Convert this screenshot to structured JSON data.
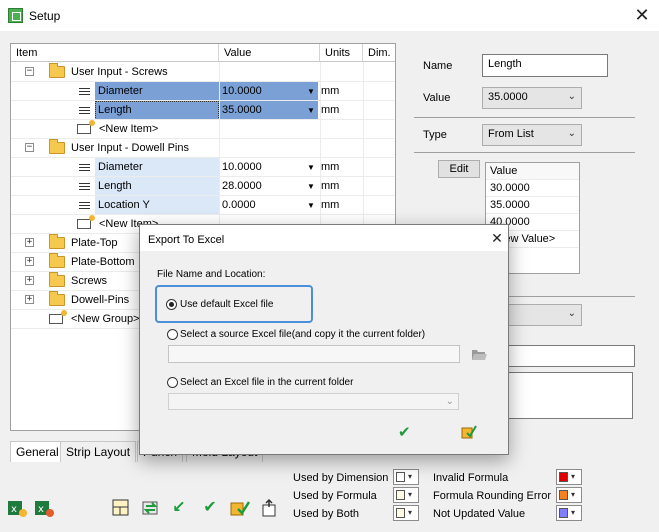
{
  "window": {
    "title": "Setup",
    "close_glyph": "✕"
  },
  "colors": {
    "selection": "#7aa0d6",
    "light_selection": "#dbe8f8",
    "invalid_formula": "#e10000",
    "rounding_error": "#f5821f",
    "not_updated": "#8080ff",
    "check_green": "#1e9b3c",
    "dialog_focus": "#4a90d9"
  },
  "tree": {
    "columns": [
      "Item",
      "Value",
      "Units",
      "Dim."
    ],
    "rows": [
      {
        "kind": "group",
        "expander": "−",
        "label": "User Input - Screws"
      },
      {
        "kind": "item",
        "name": "Diameter",
        "value": "10.0000",
        "units": "mm",
        "state": "selected"
      },
      {
        "kind": "item",
        "name": "Length",
        "value": "35.0000",
        "units": "mm",
        "state": "selected-focus"
      },
      {
        "kind": "new",
        "label": "<New Item>"
      },
      {
        "kind": "group",
        "expander": "−",
        "label": "User Input - Dowell Pins"
      },
      {
        "kind": "item",
        "name": "Diameter",
        "value": "10.0000",
        "units": "mm",
        "state": "light"
      },
      {
        "kind": "item",
        "name": "Length",
        "value": "28.0000",
        "units": "mm",
        "state": "light"
      },
      {
        "kind": "item",
        "name": "Location Y",
        "value": "0.0000",
        "units": "mm",
        "state": "light"
      },
      {
        "kind": "new",
        "label": "<New Item>"
      },
      {
        "kind": "group",
        "expander": "+",
        "label": "Plate-Top"
      },
      {
        "kind": "group",
        "expander": "+",
        "label": "Plate-Bottom"
      },
      {
        "kind": "group",
        "expander": "+",
        "label": "Screws"
      },
      {
        "kind": "group",
        "expander": "+",
        "label": "Dowell-Pins"
      },
      {
        "kind": "newgroup",
        "label": "<New Group>"
      }
    ]
  },
  "props": {
    "name_label": "Name",
    "name_value": "Length",
    "value_label": "Value",
    "value_value": "35.0000",
    "type_label": "Type",
    "type_value": "From List",
    "edit_button": "Edit",
    "list_header": "Value",
    "list_values": [
      "30.0000",
      "35.0000",
      "40.0000",
      "<New Value>"
    ]
  },
  "tabs": [
    "General",
    "Strip Layout",
    "Punch",
    "Mold Layout"
  ],
  "legend": {
    "used_by_dimension": "Used by Dimension",
    "used_by_formula": "Used by Formula",
    "used_by_both": "Used by Both",
    "invalid_formula": "Invalid Formula",
    "rounding_error": "Formula Rounding Error",
    "not_updated": "Not Updated Value"
  },
  "toolbar_icons": [
    "excel-import-icon",
    "excel-export-icon",
    "layout-icon",
    "refresh-icon",
    "check-back-icon",
    "check-icon",
    "excel-check-icon",
    "user-export-icon"
  ],
  "dialog": {
    "title": "Export To Excel",
    "close_glyph": "✕",
    "section": "File Name and Location:",
    "opt1": "Use default Excel file",
    "opt2": "Select a source Excel file(and copy it the current folder)",
    "opt3": "Select an Excel file in the current folder",
    "ok_glyph": "✔"
  }
}
